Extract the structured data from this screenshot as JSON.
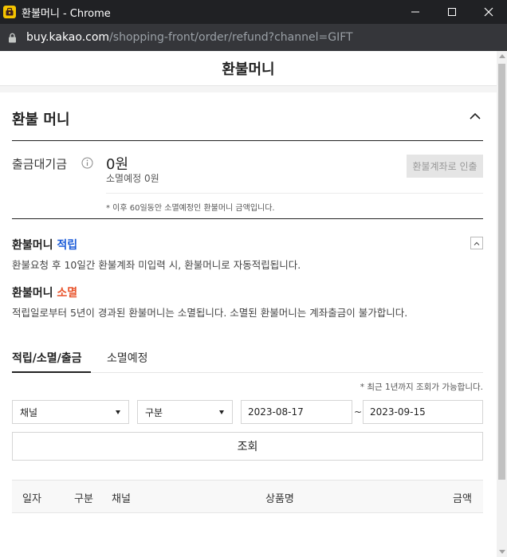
{
  "window": {
    "title": "환불머니 - Chrome",
    "url_host": "buy.kakao.com",
    "url_path": "/shopping-front/order/refund?channel=GIFT"
  },
  "page": {
    "title": "환불머니"
  },
  "section": {
    "title": "환불 머니"
  },
  "balance": {
    "label": "출금대기금",
    "amount": "0원",
    "expire_amount": "소멸예정 0원",
    "withdraw_label": "환불계좌로 인출",
    "note": "* 이후 60일동안 소멸예정인 환불머니 금액입니다."
  },
  "accrue": {
    "title_prefix": "환불머니 ",
    "title_highlight": "적립",
    "desc": "환불요청 후 10일간 환불계좌 미입력 시, 환불머니로 자동적립됩니다."
  },
  "expire": {
    "title_prefix": "환불머니 ",
    "title_highlight": "소멸",
    "desc": "적립일로부터 5년이 경과된 환불머니는 소멸됩니다. 소멸된 환불머니는 계좌출금이 불가합니다."
  },
  "tabs": [
    {
      "label": "적립/소멸/출금",
      "active": true
    },
    {
      "label": "소멸예정",
      "active": false
    }
  ],
  "filters": {
    "range_note": "* 최근 1년까지 조회가 가능합니다.",
    "channel": "채널",
    "type": "구분",
    "start_date": "2023-08-17",
    "date_separator": "~",
    "end_date": "2023-09-15",
    "search_label": "조회"
  },
  "table": {
    "headers": [
      "일자",
      "구분",
      "채널",
      "상품명",
      "금액"
    ]
  },
  "colors": {
    "accrue_highlight": "#1a5bd8",
    "expire_highlight": "#e8542c",
    "app_icon": "#f5c400"
  }
}
